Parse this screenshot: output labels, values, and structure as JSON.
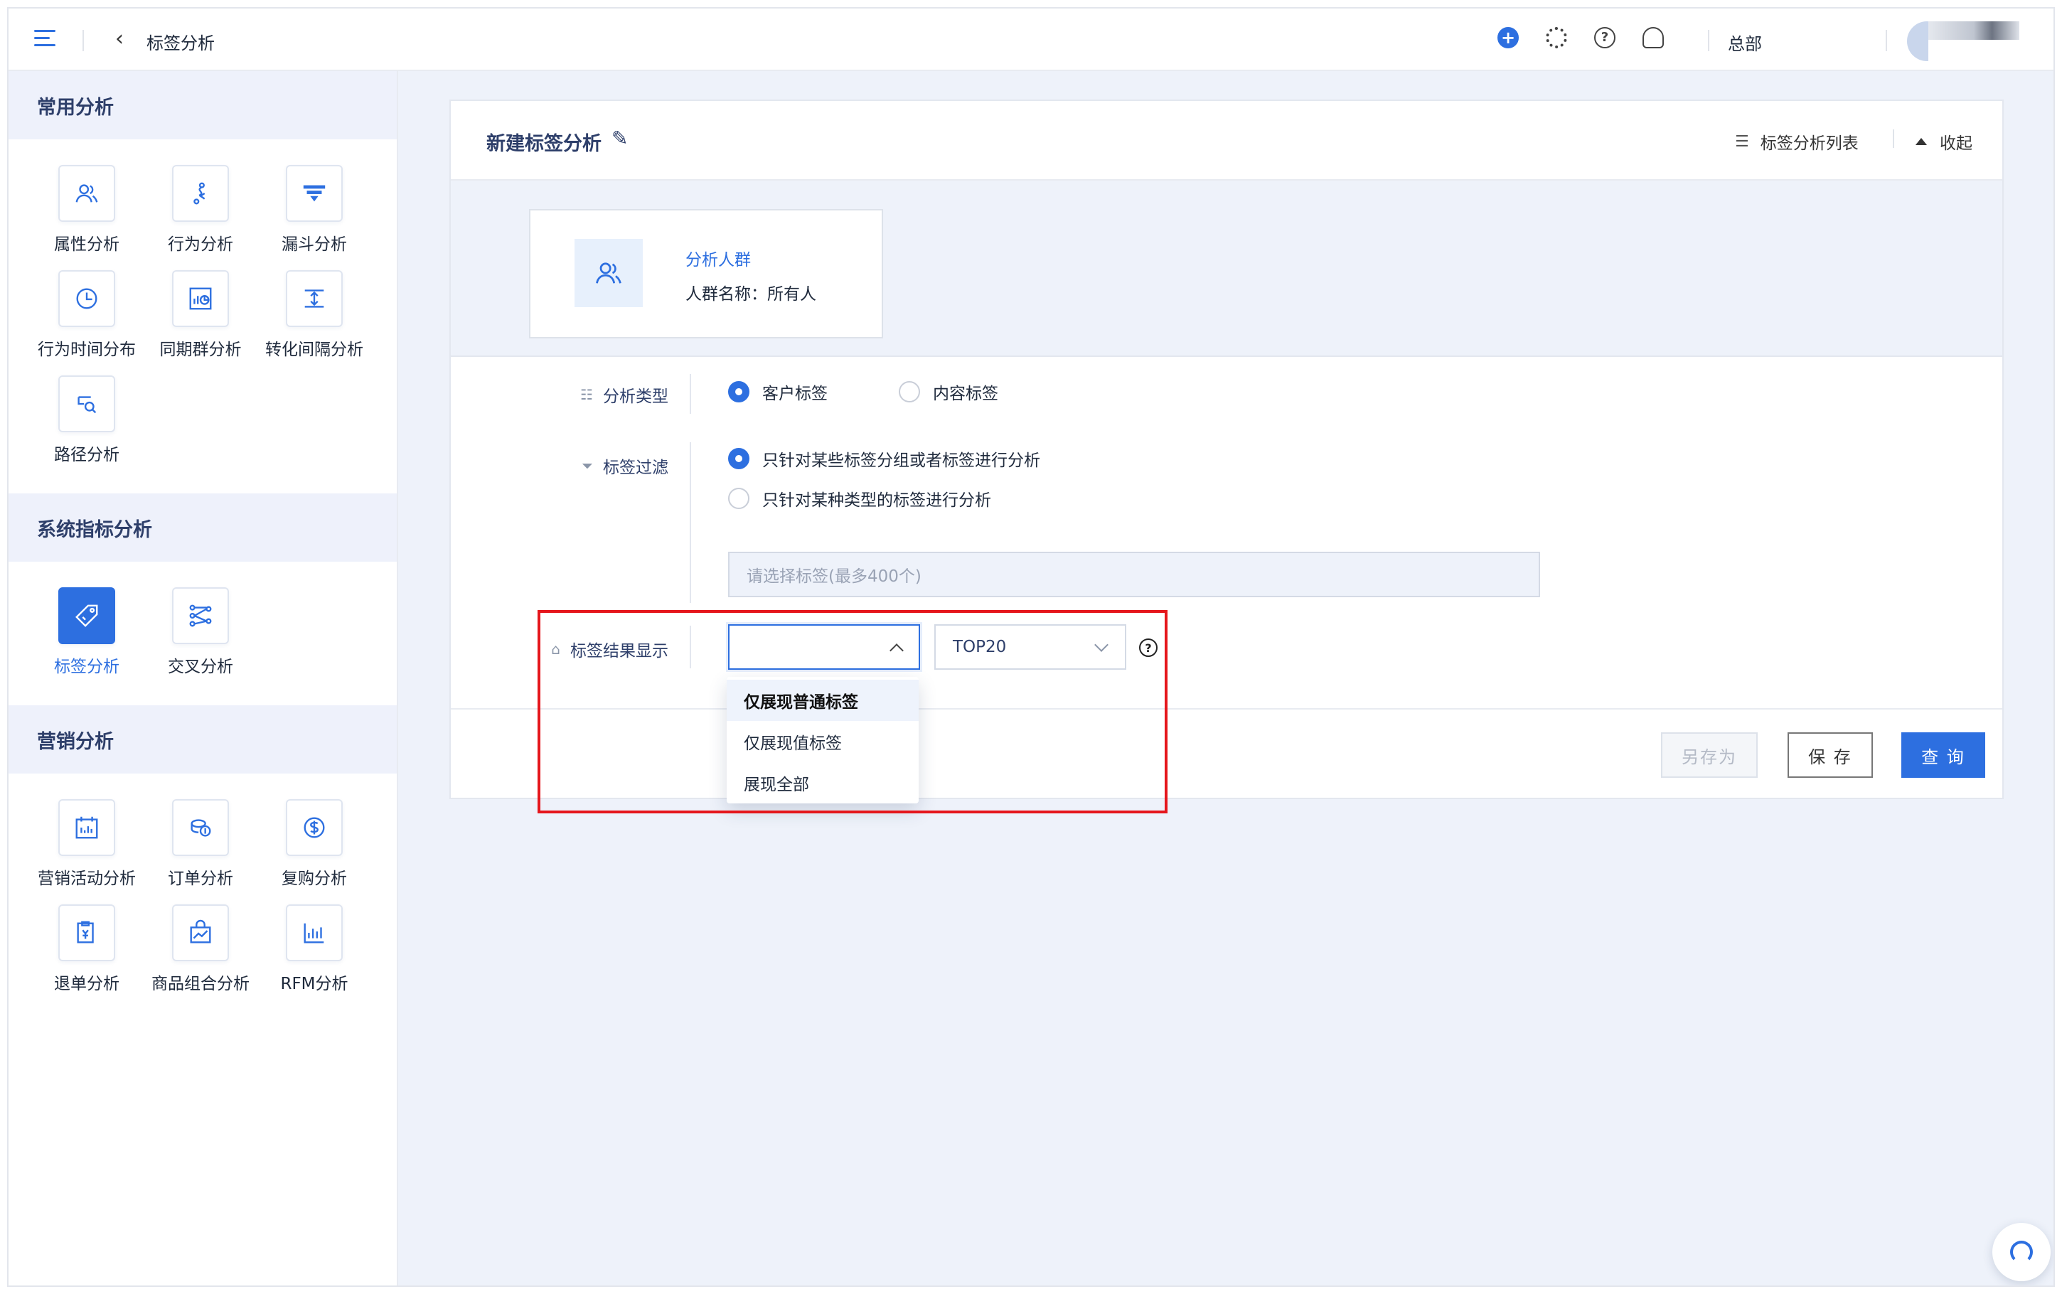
{
  "topbar": {
    "page_title": "标签分析",
    "org_name": "总部"
  },
  "sidebar": {
    "groups": [
      {
        "title": "常用分析",
        "items": [
          {
            "label": "属性分析",
            "icon": "users-icon"
          },
          {
            "label": "行为分析",
            "icon": "path-icon"
          },
          {
            "label": "漏斗分析",
            "icon": "funnel-icon"
          },
          {
            "label": "行为时间分布",
            "icon": "clock-icon"
          },
          {
            "label": "同期群分析",
            "icon": "cohort-chart-icon"
          },
          {
            "label": "转化间隔分析",
            "icon": "interval-icon"
          },
          {
            "label": "路径分析",
            "icon": "route-search-icon"
          }
        ]
      },
      {
        "title": "系统指标分析",
        "items": [
          {
            "label": "标签分析",
            "icon": "tag-icon",
            "active": true
          },
          {
            "label": "交叉分析",
            "icon": "cross-nodes-icon"
          }
        ]
      },
      {
        "title": "营销分析",
        "items": [
          {
            "label": "营销活动分析",
            "icon": "calendar-icon"
          },
          {
            "label": "订单分析",
            "icon": "coins-icon"
          },
          {
            "label": "复购分析",
            "icon": "dollar-icon"
          },
          {
            "label": "退单分析",
            "icon": "refund-icon"
          },
          {
            "label": "商品组合分析",
            "icon": "bag-chart-icon"
          },
          {
            "label": "RFM分析",
            "icon": "bar-chart-icon"
          }
        ]
      }
    ]
  },
  "card": {
    "title": "新建标签分析",
    "list_link": "标签分析列表",
    "collapse": "收起",
    "crowd": {
      "label": "分析人群",
      "name": "人群名称：所有人"
    },
    "analysis_type": {
      "label": "分析类型",
      "options": [
        "客户标签",
        "内容标签"
      ],
      "selected": "客户标签"
    },
    "tag_filter": {
      "label": "标签过滤",
      "options": [
        "只针对某些标签分组或者标签进行分析",
        "只针对某种类型的标签进行分析"
      ],
      "selected": "只针对某些标签分组或者标签进行分析",
      "placeholder": "请选择标签(最多400个)"
    },
    "result_display": {
      "label": "标签结果显示",
      "select_value": "",
      "top_value": "TOP20",
      "dropdown_options": [
        "仅展现普通标签",
        "仅展现值标签",
        "展现全部"
      ]
    },
    "buttons": {
      "save_as": "另存为",
      "save": "保 存",
      "query": "查 询"
    }
  },
  "colors": {
    "accent": "#2d6fe0",
    "highlight": "#e5161c"
  }
}
